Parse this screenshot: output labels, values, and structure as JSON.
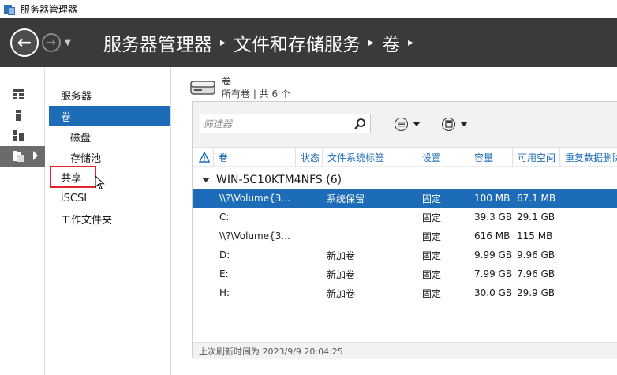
{
  "window": {
    "title": "服务器管理器"
  },
  "header": {
    "breadcrumb": [
      "服务器管理器",
      "文件和存储服务",
      "卷"
    ]
  },
  "sidebar": {
    "items": [
      {
        "label": "服务器",
        "active": false
      },
      {
        "label": "卷",
        "active": true
      },
      {
        "label": "磁盘",
        "active": false,
        "indent": true
      },
      {
        "label": "存储池",
        "active": false,
        "indent": true
      },
      {
        "label": "共享",
        "active": false,
        "highlighted": true
      },
      {
        "label": "iSCSI",
        "active": false
      },
      {
        "label": "工作文件夹",
        "active": false
      }
    ]
  },
  "volumes": {
    "title": "卷",
    "subtitle": "所有卷 | 共 6 个",
    "filter_placeholder": "筛选器",
    "columns": [
      "卷",
      "状态",
      "文件系统标签",
      "设置",
      "容量",
      "可用空间",
      "重复数据删除"
    ],
    "group": {
      "label": "WIN-5C10KTM4NFS (6)"
    },
    "rows": [
      {
        "volume": "\\\\?\\Volume{3...",
        "status": "",
        "label": "系统保留",
        "setting": "固定",
        "capacity": "100 MB",
        "free": "67.1 MB",
        "selected": true
      },
      {
        "volume": "C:",
        "status": "",
        "label": "",
        "setting": "固定",
        "capacity": "39.3 GB",
        "free": "29.1 GB",
        "selected": false
      },
      {
        "volume": "\\\\?\\Volume{3...",
        "status": "",
        "label": "",
        "setting": "固定",
        "capacity": "616 MB",
        "free": "115 MB",
        "selected": false
      },
      {
        "volume": "D:",
        "status": "",
        "label": "新加卷",
        "setting": "固定",
        "capacity": "9.99 GB",
        "free": "9.96 GB",
        "selected": false
      },
      {
        "volume": "E:",
        "status": "",
        "label": "新加卷",
        "setting": "固定",
        "capacity": "7.99 GB",
        "free": "7.96 GB",
        "selected": false
      },
      {
        "volume": "H:",
        "status": "",
        "label": "新加卷",
        "setting": "固定",
        "capacity": "30.0 GB",
        "free": "29.9 GB",
        "selected": false
      }
    ],
    "footer": "上次刷新时间为 2023/9/9 20:04:25"
  },
  "colors": {
    "accent": "#1c6cb7",
    "header_bg": "#3a3a3a",
    "highlight_box": "#e5242b"
  }
}
